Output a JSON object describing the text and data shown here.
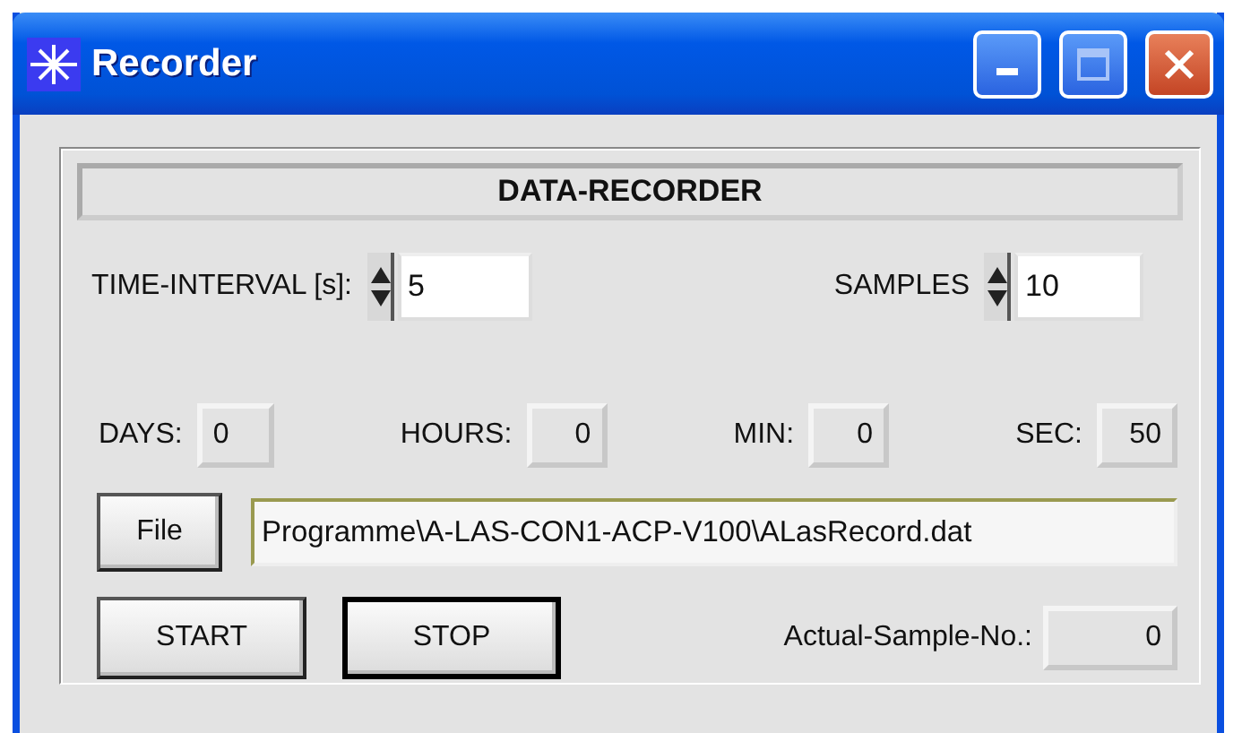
{
  "window": {
    "title": "Recorder"
  },
  "header": "DATA-RECORDER",
  "time_interval": {
    "label": "TIME-INTERVAL [s]:",
    "value": "5"
  },
  "samples": {
    "label": "SAMPLES",
    "value": "10"
  },
  "durations": [
    {
      "label": "DAYS:",
      "value": "0"
    },
    {
      "label": "HOURS:",
      "value": "0"
    },
    {
      "label": "MIN:",
      "value": "0"
    },
    {
      "label": "SEC:",
      "value": "50"
    }
  ],
  "file_button": "File",
  "file_path": "Programme\\A-LAS-CON1-ACP-V100\\ALasRecord.dat",
  "start_button": {
    "label": "START",
    "default": false
  },
  "stop_button": {
    "label": "STOP",
    "default": true
  },
  "actual_sample": {
    "label": "Actual-Sample-No.:",
    "value": "0"
  }
}
